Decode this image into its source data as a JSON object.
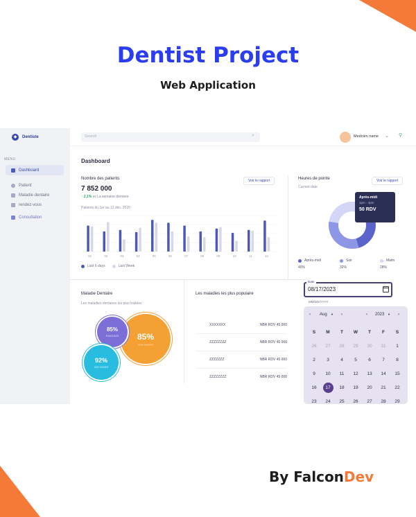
{
  "promo": {
    "title": "Dentist Project",
    "subtitle": "Web Application",
    "by": "By Falcon",
    "by_accent": "Dev",
    "accent_color": "#f47a3a",
    "title_color": "#2b3df0"
  },
  "app": {
    "logo": "Dentiste",
    "menu_label": "MENU",
    "sidebar": [
      {
        "label": "Dashboard",
        "active": true
      },
      {
        "label": "Patient"
      },
      {
        "label": "Maladie dentaire"
      },
      {
        "label": "rendez-vous"
      },
      {
        "label": "Consultation"
      }
    ],
    "search": {
      "placeholder": "Search"
    },
    "user": {
      "name": "Medcien name"
    },
    "page_title": "Dashboard",
    "patients_card": {
      "title": "Nombre des patients",
      "value": "7 852 000",
      "growth": "2.1%",
      "growth_text": "vs La semaine derniere",
      "range": "Patients du 1er au 12 déc. 2020",
      "button": "Voir le rapport",
      "legend_a": "Last 6 days",
      "legend_b": "Last Week"
    },
    "peak_card": {
      "title": "Heures de pointe",
      "subtitle": "Current date",
      "button": "Voir le rapport",
      "tooltip": {
        "title": "Après-midi",
        "time": "1pm - 4pm",
        "value": "50 RDV"
      },
      "legend": [
        {
          "label": "Après-midi",
          "value": "40%",
          "color": "#5a63c9"
        },
        {
          "label": "Soir",
          "value": "32%",
          "color": "#8e96e6"
        },
        {
          "label": "Matin",
          "value": "28%",
          "color": "#d3d6f6"
        }
      ]
    },
    "maladie_card": {
      "title": "Maladie Dentaire",
      "subtitle": "Les maladies dentaires les plus traitées",
      "bubbles": [
        {
          "pct": "85%",
          "sub": "XXXXXXX",
          "color": "#7c6ed6"
        },
        {
          "pct": "85%",
          "sub": "YYY YYYYY",
          "color": "#f5a033"
        },
        {
          "pct": "92%",
          "sub": "ZZZ ZZZZZ",
          "color": "#28bde0"
        }
      ]
    },
    "popular_card": {
      "title": "Les maladies les plus populaire",
      "rows": [
        {
          "name": "XXXXXXX",
          "value": "NBR RDV 45 000"
        },
        {
          "name": "ZZZZZZZZ",
          "value": "NBR RDV 45 000"
        },
        {
          "name": "ZZZZZZZ",
          "value": "NBR RDV 45 000"
        },
        {
          "name": "ZZZZZZZZ",
          "value": "NBR RDV 45 000"
        }
      ]
    },
    "date_picker": {
      "label": "Date",
      "value": "08/17/2023",
      "hint": "MM/DD/YYYY",
      "month": "Aug",
      "year": "2023",
      "weekdays": [
        "S",
        "M",
        "T",
        "W",
        "T",
        "F",
        "S"
      ],
      "days": [
        [
          "26",
          "27",
          "28",
          "29",
          "30",
          "31",
          "1"
        ],
        [
          "2",
          "3",
          "4",
          "5",
          "6",
          "7",
          "8"
        ],
        [
          "9",
          "10",
          "11",
          "12",
          "13",
          "14",
          "15"
        ],
        [
          "16",
          "17",
          "18",
          "19",
          "20",
          "21",
          "22"
        ],
        [
          "23",
          "24",
          "25",
          "26",
          "27",
          "28",
          "29"
        ]
      ],
      "selected": "17"
    }
  },
  "chart_data": [
    {
      "type": "bar",
      "title": "Nombre des patients",
      "categories": [
        "01",
        "02",
        "03",
        "04",
        "05",
        "06",
        "07",
        "08",
        "09",
        "10",
        "11",
        "12"
      ],
      "series": [
        {
          "name": "Last 6 days",
          "values": [
            72,
            56,
            60,
            54,
            88,
            80,
            72,
            56,
            64,
            52,
            60,
            86
          ]
        },
        {
          "name": "Last Week",
          "values": [
            70,
            82,
            34,
            66,
            80,
            56,
            42,
            40,
            68,
            30,
            58,
            40
          ]
        }
      ],
      "colors": [
        "#4e58b8",
        "#d7d8e6"
      ],
      "ylim": [
        0,
        100
      ]
    },
    {
      "type": "pie",
      "title": "Heures de pointe",
      "categories": [
        "Après-midi",
        "Soir",
        "Matin"
      ],
      "values": [
        40,
        32,
        28
      ],
      "colors": [
        "#5a63c9",
        "#8e96e6",
        "#d3d6f6"
      ]
    }
  ]
}
